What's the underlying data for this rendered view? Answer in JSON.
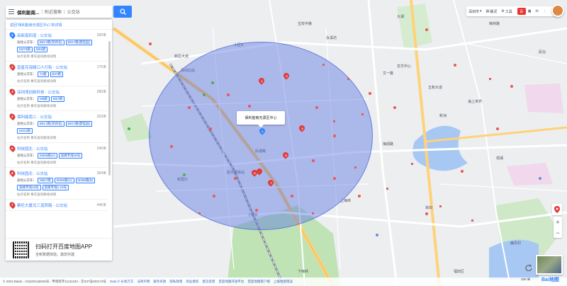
{
  "search": {
    "query": "保利能南...",
    "separator": "|",
    "sub_hint": "附近搜索",
    "category": "公交站"
  },
  "panel": {
    "back_link": "返回\"保利能南无源区中心\"的详情",
    "stops": [
      {
        "idx": "1",
        "color": "blue",
        "name": "高新南四道 - 公交站",
        "dist": "390米",
        "lines_label": "途经公交车：",
        "lines": [
          "B817路(深圳北)",
          "B817路(碧桂园)",
          "M370路",
          "M81路"
        ],
        "foot": "站点名称  乘车查询路线详情"
      },
      {
        "idx": "2",
        "color": "red",
        "name": "蓝星花海路口人行街 - 公交站",
        "dist": "175米",
        "lines_label": "途经公交车：",
        "lines": [
          "71路",
          "B37路"
        ],
        "foot": "站点名称  乘车查询路线详情"
      },
      {
        "idx": "3",
        "color": "red",
        "name": "深圳湾创新科技 - 公交站",
        "dist": "280米",
        "lines_label": "途经公交车：",
        "lines": [
          "M8路",
          "M57路"
        ],
        "foot": "站点名称  乘车查询路线详情"
      },
      {
        "idx": "4",
        "color": "red",
        "name": "保利能南二 - 公交站",
        "dist": "263米",
        "lines_label": "途经公交车：",
        "lines": [
          "B817路(深圳北)",
          "B817路(碧桂园)",
          "M421路"
        ],
        "foot": "站点名称  乘车查询路线详情"
      },
      {
        "idx": "5",
        "color": "red",
        "name": "科技园北 - 公交站",
        "dist": "246米",
        "lines_label": "途经公交车：",
        "lines": [
          "M366路(A)",
          "高峰专线18号"
        ],
        "foot": "站点名称  乘车查询路线详情"
      },
      {
        "idx": "6",
        "color": "red",
        "name": "科技园北 - 公交站",
        "dist": "284米",
        "lines_label": "途经公交车：",
        "lines": [
          "M817路",
          "M366路(A)",
          "M366路(B)",
          "高峰专线18号",
          "高峰专线1-10号"
        ],
        "foot": "站点名称  乘车查询路线详情"
      },
      {
        "idx": "7",
        "color": "red",
        "name": "蔡伦大厦北三道西路 - 公交站",
        "dist": "446米",
        "lines_label": "",
        "lines": [],
        "foot": ""
      }
    ],
    "qr_title": "扫码打开百度地图APP",
    "qr_sub": "全新数据体验，激您共建"
  },
  "popup": {
    "text": "保利能南无源区中心"
  },
  "toolbar": {
    "city": "深圳市",
    "layers": "路况",
    "tools": "工具",
    "logo": "百"
  },
  "map_labels": [
    "新区大道",
    "深圳北站",
    "汝溪坊",
    "文一路",
    "民塘路",
    "宝安中路",
    "五和大道",
    "民治",
    "梅林路",
    "海上世界",
    "新洲",
    "观澜",
    "龙华中心",
    "鹿丹村",
    "坂田",
    "梅观路",
    "民乐地铁站",
    "上梅林",
    "新围仔",
    "下梅林",
    "小区A",
    "小区B",
    "福田区",
    "大湖"
  ],
  "footer": {
    "copyright": "© 2023 Baidu - GS(2021)6026号 - 甲测资字11111342 - 京ICP证030173号",
    "links": [
      "Data © 长地万方",
      "法律声明",
      "服务条款",
      "隐私政策",
      "商业授权",
      "意见反馈",
      "百度地图开放平台",
      "百度地图客户端",
      "上报地图错误"
    ],
    "scale": "100 米",
    "brand": "Bai地图"
  },
  "colors": {
    "accent": "#3385ff",
    "marker_red": "#e23b3b",
    "circle": "#5a76e2"
  }
}
